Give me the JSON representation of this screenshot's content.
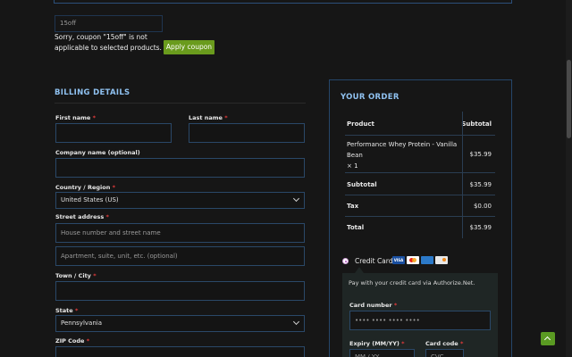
{
  "coupon": {
    "input_value": "15off",
    "error_message": "Sorry, coupon \"15off\" is not applicable to selected products.",
    "apply_label": "Apply coupon"
  },
  "billing": {
    "title": "BILLING DETAILS",
    "first_name_label": "First name",
    "last_name_label": "Last name",
    "company_label": "Company name (optional)",
    "country_label": "Country / Region",
    "country_value": "United States (US)",
    "street_label": "Street address",
    "street_placeholder": "House number and street name",
    "apartment_placeholder": "Apartment, suite, unit, etc. (optional)",
    "city_label": "Town / City",
    "state_label": "State",
    "state_value": "Pennsylvania",
    "zip_label": "ZIP Code",
    "required_mark": "*"
  },
  "order": {
    "title": "YOUR ORDER",
    "col_product": "Product",
    "col_subtotal": "Subtotal",
    "item_name": "Performance Whey Protein - Vanilla Bean",
    "item_qty": "× 1",
    "item_price": "$35.99",
    "subtotal_label": "Subtotal",
    "subtotal_value": "$35.99",
    "tax_label": "Tax",
    "tax_value": "$0.00",
    "total_label": "Total",
    "total_value": "$35.99"
  },
  "payment": {
    "method_label": "Credit Card",
    "card_icons": [
      "visa-icon",
      "mastercard-icon",
      "amex-icon",
      "discover-icon"
    ],
    "description": "Pay with your credit card via Authorize.Net.",
    "card_number_label": "Card number",
    "card_number_placeholder": "•••• •••• •••• ••••",
    "expiry_label": "Expiry (MM/YY)",
    "card_code_label": "Card code",
    "expiry_placeholder": "MM / YY",
    "cvc_placeholder": "CVC"
  },
  "colors": {
    "accent": "#8fc1f0",
    "button": "#6a9b1d",
    "required": "#e23b3b",
    "field_border": "#2a4868"
  }
}
